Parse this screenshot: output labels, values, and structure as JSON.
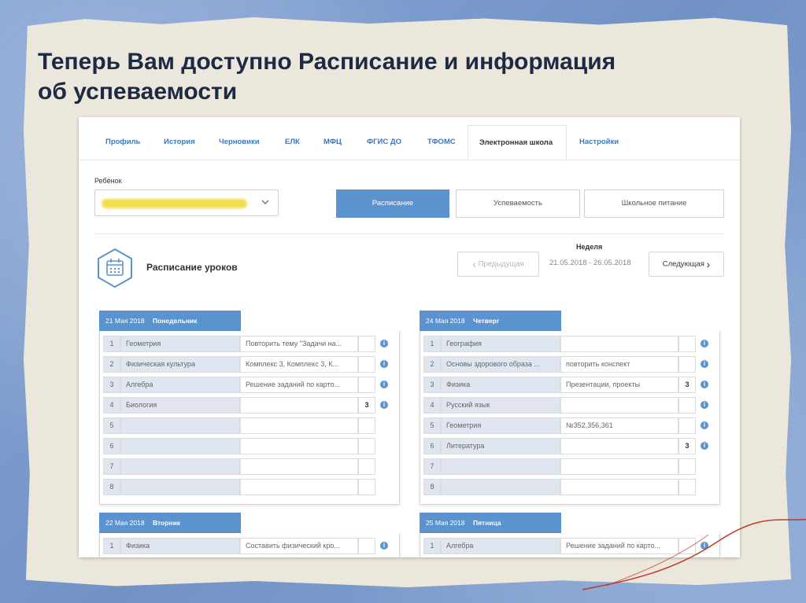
{
  "slide": {
    "title_line1": "Теперь Вам доступно Расписание и информация",
    "title_line2": "об успеваемости"
  },
  "tabs": [
    {
      "label": "Профиль"
    },
    {
      "label": "История"
    },
    {
      "label": "Черновики"
    },
    {
      "label": "ЕЛК"
    },
    {
      "label": "МФЦ"
    },
    {
      "label": "ФГИС ДО"
    },
    {
      "label": "ТФОМС"
    },
    {
      "label": "Электронная школа"
    },
    {
      "label": "Настройки"
    }
  ],
  "active_tab": "Электронная школа",
  "child": {
    "label": "Ребёнок",
    "icon": "chevron-down-icon"
  },
  "segments": [
    {
      "label": "Расписание"
    },
    {
      "label": "Успеваемость"
    },
    {
      "label": "Школьное питание"
    }
  ],
  "schedule": {
    "title": "Расписание уроков",
    "icon": "calendar-icon",
    "prev_label": "Предыдущая",
    "next_label": "Следующая",
    "week_label": "Неделя",
    "week_range": "21.05.2018 - 26.05.2018"
  },
  "days": [
    {
      "date": "21 Мая 2018",
      "name": "Понедельник",
      "lessons": [
        {
          "num": "1",
          "subject": "Геометрия",
          "homework": "Повторить тему \"Задачи на...",
          "grade": "",
          "info": true
        },
        {
          "num": "2",
          "subject": "Физическая культура",
          "homework": "Комплекс 3, Комплекс 3, К...",
          "grade": "",
          "info": true
        },
        {
          "num": "3",
          "subject": "Алгебра",
          "homework": "Решение заданий по карто...",
          "grade": "",
          "info": true
        },
        {
          "num": "4",
          "subject": "Биология",
          "homework": "",
          "grade": "3",
          "info": true
        },
        {
          "num": "5",
          "subject": "",
          "homework": "",
          "grade": "",
          "info": false
        },
        {
          "num": "6",
          "subject": "",
          "homework": "",
          "grade": "",
          "info": false
        },
        {
          "num": "7",
          "subject": "",
          "homework": "",
          "grade": "",
          "info": false
        },
        {
          "num": "8",
          "subject": "",
          "homework": "",
          "grade": "",
          "info": false
        }
      ]
    },
    {
      "date": "24 Мая 2018",
      "name": "Четверг",
      "lessons": [
        {
          "num": "1",
          "subject": "География",
          "homework": "",
          "grade": "",
          "info": true
        },
        {
          "num": "2",
          "subject": "Основы здорового образа ...",
          "homework": "повторить конспект",
          "grade": "",
          "info": true
        },
        {
          "num": "3",
          "subject": "Физика",
          "homework": "Презентации, проекты",
          "grade": "3",
          "info": true
        },
        {
          "num": "4",
          "subject": "Русский язык",
          "homework": "",
          "grade": "",
          "info": true
        },
        {
          "num": "5",
          "subject": "Геометрия",
          "homework": "№352,356,361",
          "grade": "",
          "info": true
        },
        {
          "num": "6",
          "subject": "Литература",
          "homework": "",
          "grade": "3",
          "info": true
        },
        {
          "num": "7",
          "subject": "",
          "homework": "",
          "grade": "",
          "info": false
        },
        {
          "num": "8",
          "subject": "",
          "homework": "",
          "grade": "",
          "info": false
        }
      ]
    },
    {
      "date": "22 Мая 2018",
      "name": "Вторник",
      "lessons": [
        {
          "num": "1",
          "subject": "Физика",
          "homework": "Составить физический кро...",
          "grade": "",
          "info": true
        }
      ]
    },
    {
      "date": "25 Мая 2018",
      "name": "Пятница",
      "lessons": [
        {
          "num": "1",
          "subject": "Алгебра",
          "homework": "Решение заданий по карто...",
          "grade": "",
          "info": true
        }
      ]
    }
  ],
  "colors": {
    "accent": "#5b93cf",
    "tab_link": "#3b78c2",
    "title": "#1d2a44",
    "paper": "#ece7dc",
    "background": "#7f9fcf"
  }
}
